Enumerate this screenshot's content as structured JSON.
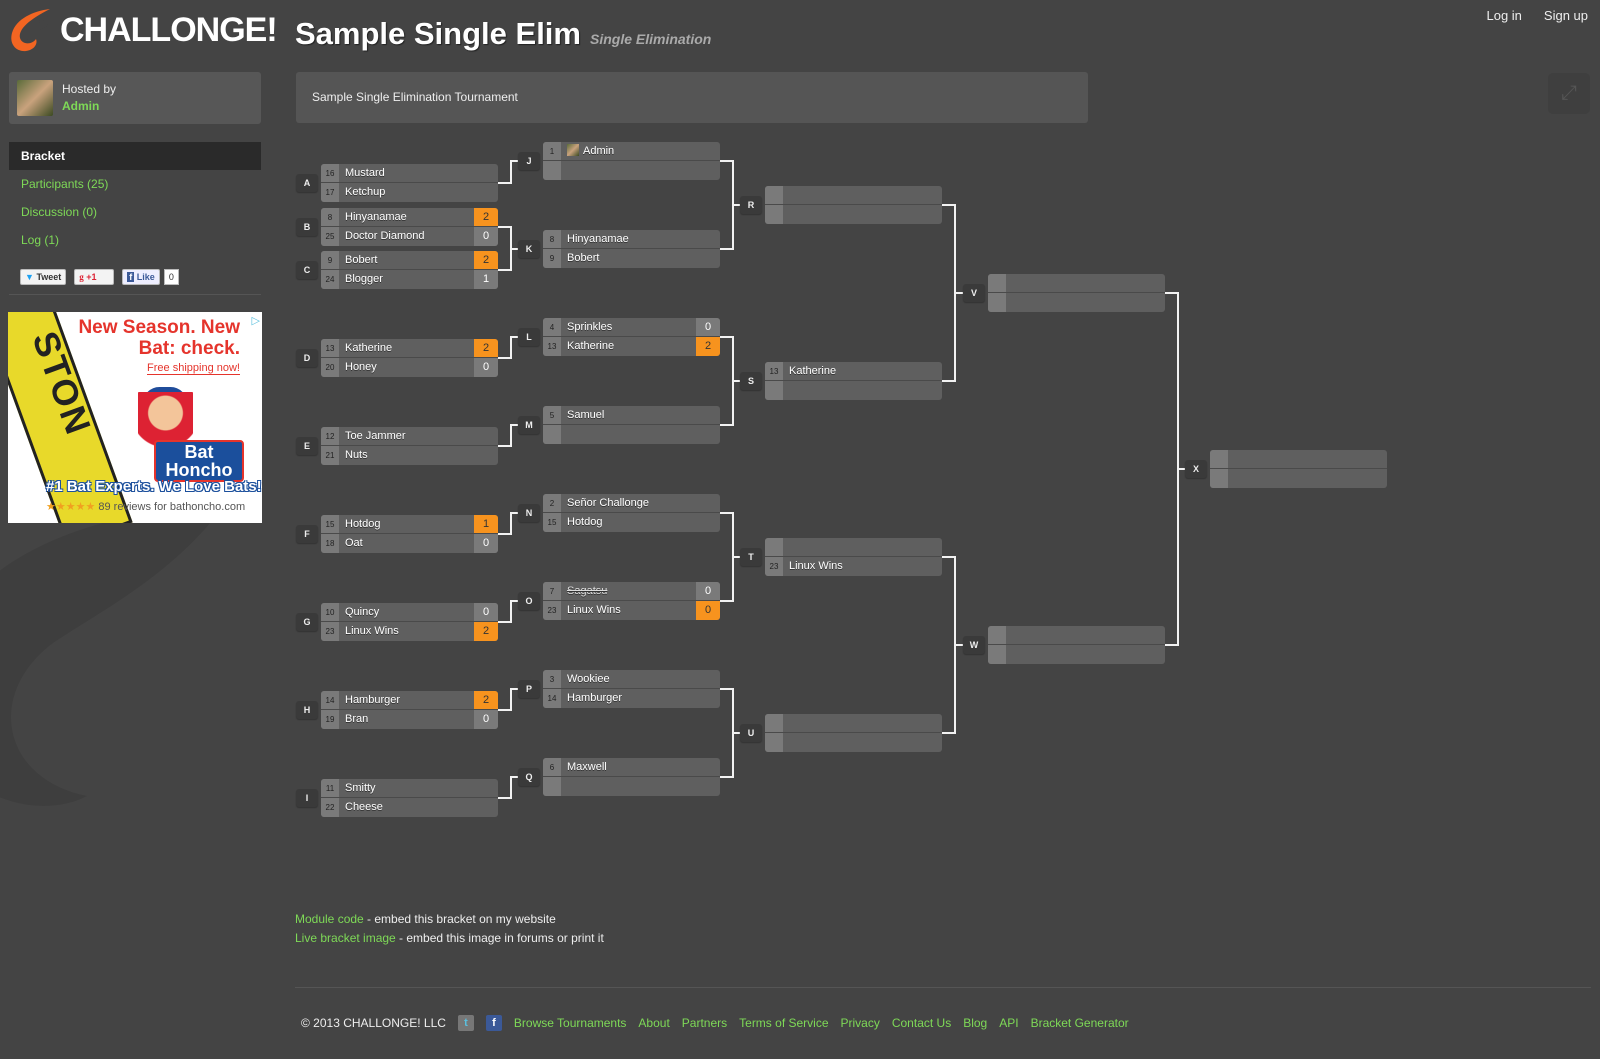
{
  "brand": {
    "name": "CHALLONGE!",
    "accent": "#f26522"
  },
  "header": {
    "title": "Sample Single Elim",
    "subtitle": "Single Elimination",
    "login": "Log in",
    "signup": "Sign up"
  },
  "host": {
    "label": "Hosted by",
    "name": "Admin"
  },
  "sidebar": {
    "items": [
      {
        "label": "Bracket",
        "active": true
      },
      {
        "label": "Participants (25)"
      },
      {
        "label": "Discussion (0)"
      },
      {
        "label": "Log (1)"
      }
    ],
    "social": {
      "tweet": "Tweet",
      "gplus": "+1",
      "like": "Like",
      "like_count": "0"
    }
  },
  "ad": {
    "headline": "New Season. New Bat: check.",
    "subline": "Free shipping now!",
    "brand": "Bat Honcho",
    "tagline": "#1 Bat Experts. We Love Bats!",
    "stars": "★★★★★",
    "reviews": "89 reviews for bathoncho.com",
    "bat_text": "STON"
  },
  "description": "Sample Single Elimination Tournament",
  "colors": {
    "winner": "#f7931e",
    "link": "#7ed957",
    "background": "#444444"
  },
  "bracket": {
    "matches": [
      {
        "id": "A",
        "p": [
          {
            "seed": "16",
            "name": "Mustard"
          },
          {
            "seed": "17",
            "name": "Ketchup"
          }
        ]
      },
      {
        "id": "B",
        "p": [
          {
            "seed": "8",
            "name": "Hinyanamae",
            "score": "2",
            "win": true
          },
          {
            "seed": "25",
            "name": "Doctor Diamond",
            "score": "0"
          }
        ]
      },
      {
        "id": "C",
        "p": [
          {
            "seed": "9",
            "name": "Bobert",
            "score": "2",
            "win": true
          },
          {
            "seed": "24",
            "name": "Blogger",
            "score": "1"
          }
        ]
      },
      {
        "id": "D",
        "p": [
          {
            "seed": "13",
            "name": "Katherine",
            "score": "2",
            "win": true
          },
          {
            "seed": "20",
            "name": "Honey",
            "score": "0"
          }
        ]
      },
      {
        "id": "E",
        "p": [
          {
            "seed": "12",
            "name": "Toe Jammer"
          },
          {
            "seed": "21",
            "name": "Nuts"
          }
        ]
      },
      {
        "id": "F",
        "p": [
          {
            "seed": "15",
            "name": "Hotdog",
            "score": "1",
            "win": true
          },
          {
            "seed": "18",
            "name": "Oat",
            "score": "0"
          }
        ]
      },
      {
        "id": "G",
        "p": [
          {
            "seed": "10",
            "name": "Quincy",
            "score": "0"
          },
          {
            "seed": "23",
            "name": "Linux Wins",
            "score": "2",
            "win": true
          }
        ]
      },
      {
        "id": "H",
        "p": [
          {
            "seed": "14",
            "name": "Hamburger",
            "score": "2",
            "win": true
          },
          {
            "seed": "19",
            "name": "Bran",
            "score": "0"
          }
        ]
      },
      {
        "id": "I",
        "p": [
          {
            "seed": "11",
            "name": "Smitty"
          },
          {
            "seed": "22",
            "name": "Cheese"
          }
        ]
      },
      {
        "id": "J",
        "p": [
          {
            "seed": "1",
            "name": "Admin",
            "avatar": true
          },
          {}
        ]
      },
      {
        "id": "K",
        "p": [
          {
            "seed": "8",
            "name": "Hinyanamae"
          },
          {
            "seed": "9",
            "name": "Bobert"
          }
        ]
      },
      {
        "id": "L",
        "p": [
          {
            "seed": "4",
            "name": "Sprinkles",
            "score": "0"
          },
          {
            "seed": "13",
            "name": "Katherine",
            "score": "2",
            "win": true
          }
        ]
      },
      {
        "id": "M",
        "p": [
          {
            "seed": "5",
            "name": "Samuel"
          },
          {}
        ]
      },
      {
        "id": "N",
        "p": [
          {
            "seed": "2",
            "name": "Señor Challonge"
          },
          {
            "seed": "15",
            "name": "Hotdog"
          }
        ]
      },
      {
        "id": "O",
        "p": [
          {
            "seed": "7",
            "name": "Sagatsu",
            "score": "0",
            "lost": true
          },
          {
            "seed": "23",
            "name": "Linux Wins",
            "score": "0",
            "win": true
          }
        ]
      },
      {
        "id": "P",
        "p": [
          {
            "seed": "3",
            "name": "Wookiee"
          },
          {
            "seed": "14",
            "name": "Hamburger"
          }
        ]
      },
      {
        "id": "Q",
        "p": [
          {
            "seed": "6",
            "name": "Maxwell"
          },
          {}
        ]
      },
      {
        "id": "R",
        "p": [
          {},
          {}
        ]
      },
      {
        "id": "S",
        "p": [
          {
            "seed": "13",
            "name": "Katherine"
          },
          {}
        ]
      },
      {
        "id": "T",
        "p": [
          {},
          {
            "seed": "23",
            "name": "Linux Wins"
          }
        ]
      },
      {
        "id": "U",
        "p": [
          {},
          {}
        ]
      },
      {
        "id": "V",
        "p": [
          {},
          {}
        ]
      },
      {
        "id": "W",
        "p": [
          {},
          {}
        ]
      },
      {
        "id": "X",
        "p": [
          {},
          {}
        ]
      }
    ],
    "feeds": [
      [
        "A",
        "J"
      ],
      [
        "B",
        "K"
      ],
      [
        "C",
        "K"
      ],
      [
        "D",
        "L"
      ],
      [
        "E",
        "M"
      ],
      [
        "F",
        "N"
      ],
      [
        "G",
        "O"
      ],
      [
        "H",
        "P"
      ],
      [
        "I",
        "Q"
      ],
      [
        "J",
        "R"
      ],
      [
        "K",
        "R"
      ],
      [
        "L",
        "S"
      ],
      [
        "M",
        "S"
      ],
      [
        "N",
        "T"
      ],
      [
        "O",
        "T"
      ],
      [
        "P",
        "U"
      ],
      [
        "Q",
        "U"
      ],
      [
        "R",
        "V"
      ],
      [
        "S",
        "V"
      ],
      [
        "T",
        "W"
      ],
      [
        "U",
        "W"
      ],
      [
        "V",
        "X"
      ],
      [
        "W",
        "X"
      ]
    ]
  },
  "embed": {
    "module_link": "Module code",
    "module_text": " - embed this bracket on my website",
    "image_link": "Live bracket image",
    "image_text": " - embed this image in forums or print it"
  },
  "footer": {
    "copyright": "© 2013 CHALLONGE! LLC",
    "links": [
      "Browse Tournaments",
      "About",
      "Partners",
      "Terms of Service",
      "Privacy",
      "Contact Us",
      "Blog",
      "API",
      "Bracket Generator"
    ]
  }
}
